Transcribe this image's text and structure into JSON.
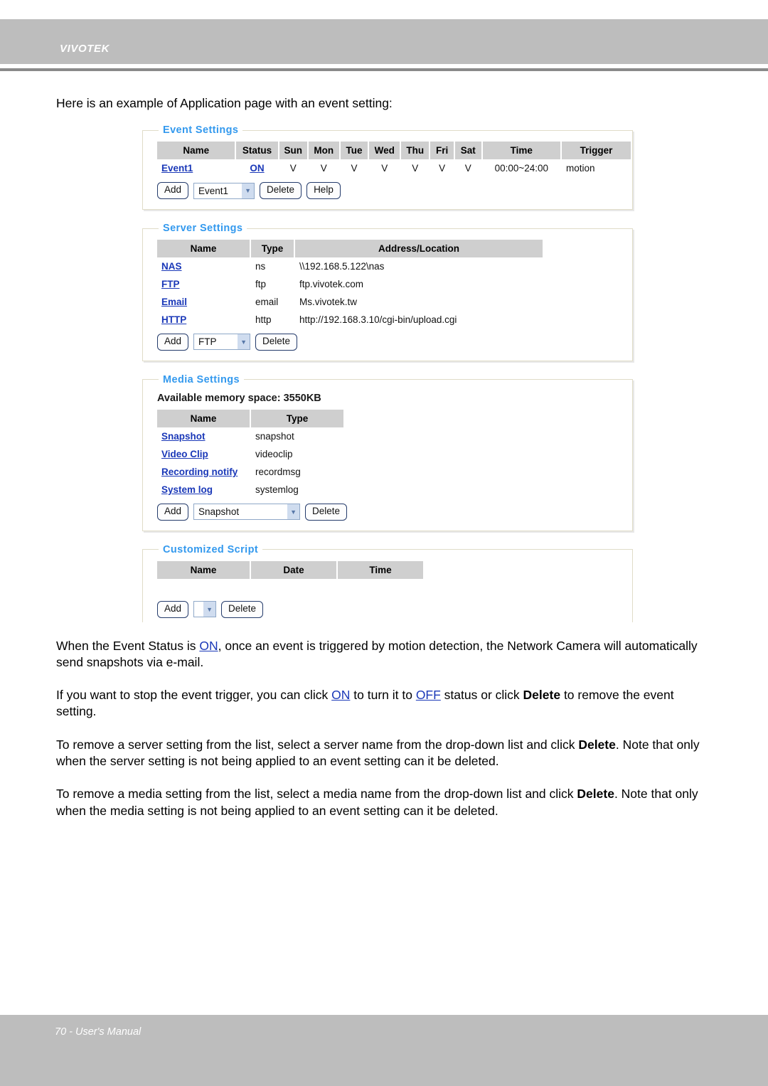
{
  "header": {
    "brand": "VIVOTEK"
  },
  "intro": "Here is an example of Application page with an event setting:",
  "screenshot": {
    "event_settings": {
      "legend": "Event Settings",
      "columns": [
        "Name",
        "Status",
        "Sun",
        "Mon",
        "Tue",
        "Wed",
        "Thu",
        "Fri",
        "Sat",
        "Time",
        "Trigger"
      ],
      "row": {
        "name": "Event1",
        "status": "ON",
        "sun": "V",
        "mon": "V",
        "tue": "V",
        "wed": "V",
        "thu": "V",
        "fri": "V",
        "sat": "V",
        "time": "00:00~24:00",
        "trigger": "motion"
      },
      "controls": {
        "add_label": "Add",
        "select_value": "Event1",
        "delete_label": "Delete",
        "help_label": "Help"
      }
    },
    "server_settings": {
      "legend": "Server Settings",
      "columns": [
        "Name",
        "Type",
        "Address/Location"
      ],
      "rows": [
        {
          "name": "NAS",
          "type": "ns",
          "address": "\\\\192.168.5.122\\nas"
        },
        {
          "name": "FTP",
          "type": "ftp",
          "address": "ftp.vivotek.com"
        },
        {
          "name": "Email",
          "type": "email",
          "address": "Ms.vivotek.tw"
        },
        {
          "name": "HTTP",
          "type": "http",
          "address": "http://192.168.3.10/cgi-bin/upload.cgi"
        }
      ],
      "controls": {
        "add_label": "Add",
        "select_value": "FTP",
        "delete_label": "Delete"
      }
    },
    "media_settings": {
      "legend": "Media Settings",
      "memory_line": "Available memory space: 3550KB",
      "columns": [
        "Name",
        "Type"
      ],
      "rows": [
        {
          "name": "Snapshot",
          "type": "snapshot"
        },
        {
          "name": "Video Clip",
          "type": "videoclip"
        },
        {
          "name": "Recording notify",
          "type": "recordmsg"
        },
        {
          "name": "System log",
          "type": "systemlog"
        }
      ],
      "controls": {
        "add_label": "Add",
        "select_value": "Snapshot",
        "delete_label": "Delete"
      }
    },
    "customized_script": {
      "legend": "Customized Script",
      "columns": [
        "Name",
        "Date",
        "Time"
      ],
      "controls": {
        "add_label": "Add",
        "select_value": "",
        "delete_label": "Delete"
      }
    }
  },
  "paragraphs": {
    "p1_a": "When the Event Status is ",
    "p1_link": "ON",
    "p1_b": ", once an event is triggered by motion detection, the Network Camera will automatically send snapshots via e-mail.",
    "p2_a": "If you want to stop the event trigger, you can click ",
    "p2_link1": "ON",
    "p2_b": " to turn it to ",
    "p2_link2": "OFF",
    "p2_c": " status or click ",
    "p2_bold": "Delete",
    "p2_d": " to remove the event setting.",
    "p3_a": "To remove a server setting from the list, select a server name from the drop-down list and click ",
    "p3_bold": "Delete",
    "p3_b": ". Note that only when the server setting is not being applied to an event setting can it be deleted.",
    "p4_a": "To remove a media setting from the list, select a media name from the drop-down list and click ",
    "p4_bold": "Delete",
    "p4_b": ". Note that only when the media setting is not being applied to an event setting can it be deleted."
  },
  "footer": {
    "text": "70 - User's Manual"
  }
}
